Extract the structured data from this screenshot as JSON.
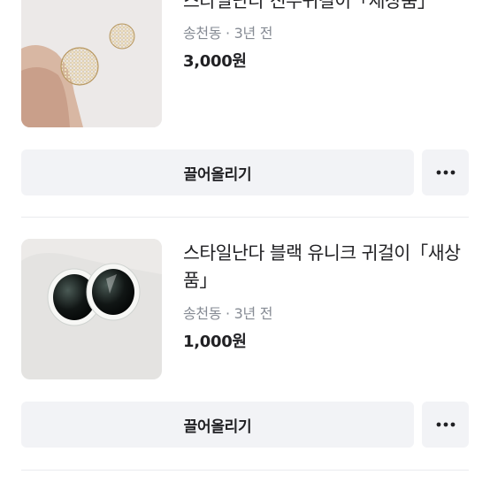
{
  "items": [
    {
      "title": "스타일난다 진주귀걸이「새상품」",
      "meta": "송천동 · 3년 전",
      "price": "3,000원",
      "bump_label": "끌어올리기",
      "thumbnail": "pearl-earrings-photo"
    },
    {
      "title": "스타일난다 블랙 유니크 귀걸이「새상품」",
      "meta": "송천동 · 3년 전",
      "price": "1,000원",
      "bump_label": "끌어올리기",
      "thumbnail": "black-earrings-photo"
    }
  ],
  "icons": {
    "more": "more-horizontal-icon"
  },
  "colors": {
    "button_bg": "#f2f3f6",
    "text_primary": "#212124",
    "text_secondary": "#868b94",
    "divider": "#eaebee"
  }
}
